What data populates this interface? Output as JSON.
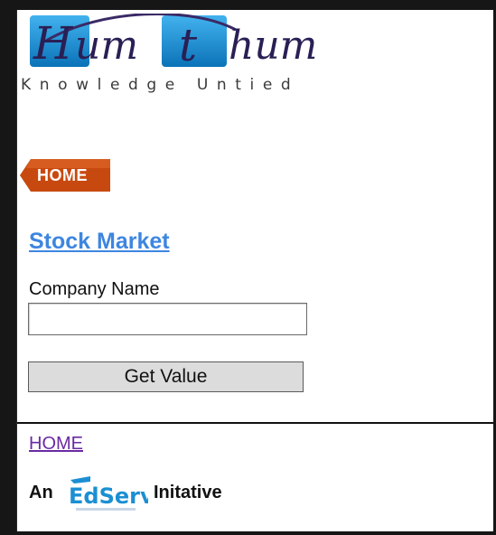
{
  "logo": {
    "brand": "Hum t hum",
    "tagline": "Knowledge Untied"
  },
  "nav": {
    "home_badge": "HOME"
  },
  "main": {
    "title_link": "Stock Market",
    "company_label": "Company Name",
    "company_value": "",
    "get_value_button": "Get Value"
  },
  "footer": {
    "home_link": "HOME",
    "initiative_prefix": "An",
    "initiative_brand": "EdServ",
    "initiative_suffix": "Initative"
  },
  "colors": {
    "link_blue": "#3d86e0",
    "visited_purple": "#6a2aa3",
    "badge_orange": "#c8490f",
    "logo_blue": "#1b8fd3"
  }
}
